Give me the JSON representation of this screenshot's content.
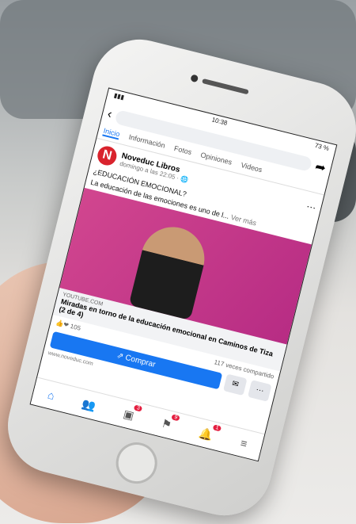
{
  "status": {
    "time": "10:38",
    "battery": "73 %"
  },
  "tabs": [
    "Inicio",
    "Información",
    "Fotos",
    "Opiniones",
    "Videos"
  ],
  "post": {
    "page_name": "Noveduc Libros",
    "time": "domingo a las 22:05 · ",
    "headline": "¿EDUCACIÓN EMOCIONAL?",
    "text": "La educación de las emociones es uno de l...",
    "see_more": "Ver más",
    "source": "YOUTUBE.COM",
    "link_title": "Miradas en torno de la educación emocional en Caminos de Tiza (2 de 4)",
    "reactions": "105",
    "shares": "117 veces compartido"
  },
  "actions": {
    "buy_label": "Comprar",
    "url": "www.noveduc.com"
  },
  "nav_badges": {
    "marketplace": "3",
    "flags": "9",
    "bell": "1"
  },
  "logo_letter": "N",
  "icons": {
    "home": "home-icon",
    "people": "people-icon",
    "store": "store-icon",
    "flag": "flag-icon",
    "bell": "bell-icon",
    "menu": "menu-icon"
  }
}
